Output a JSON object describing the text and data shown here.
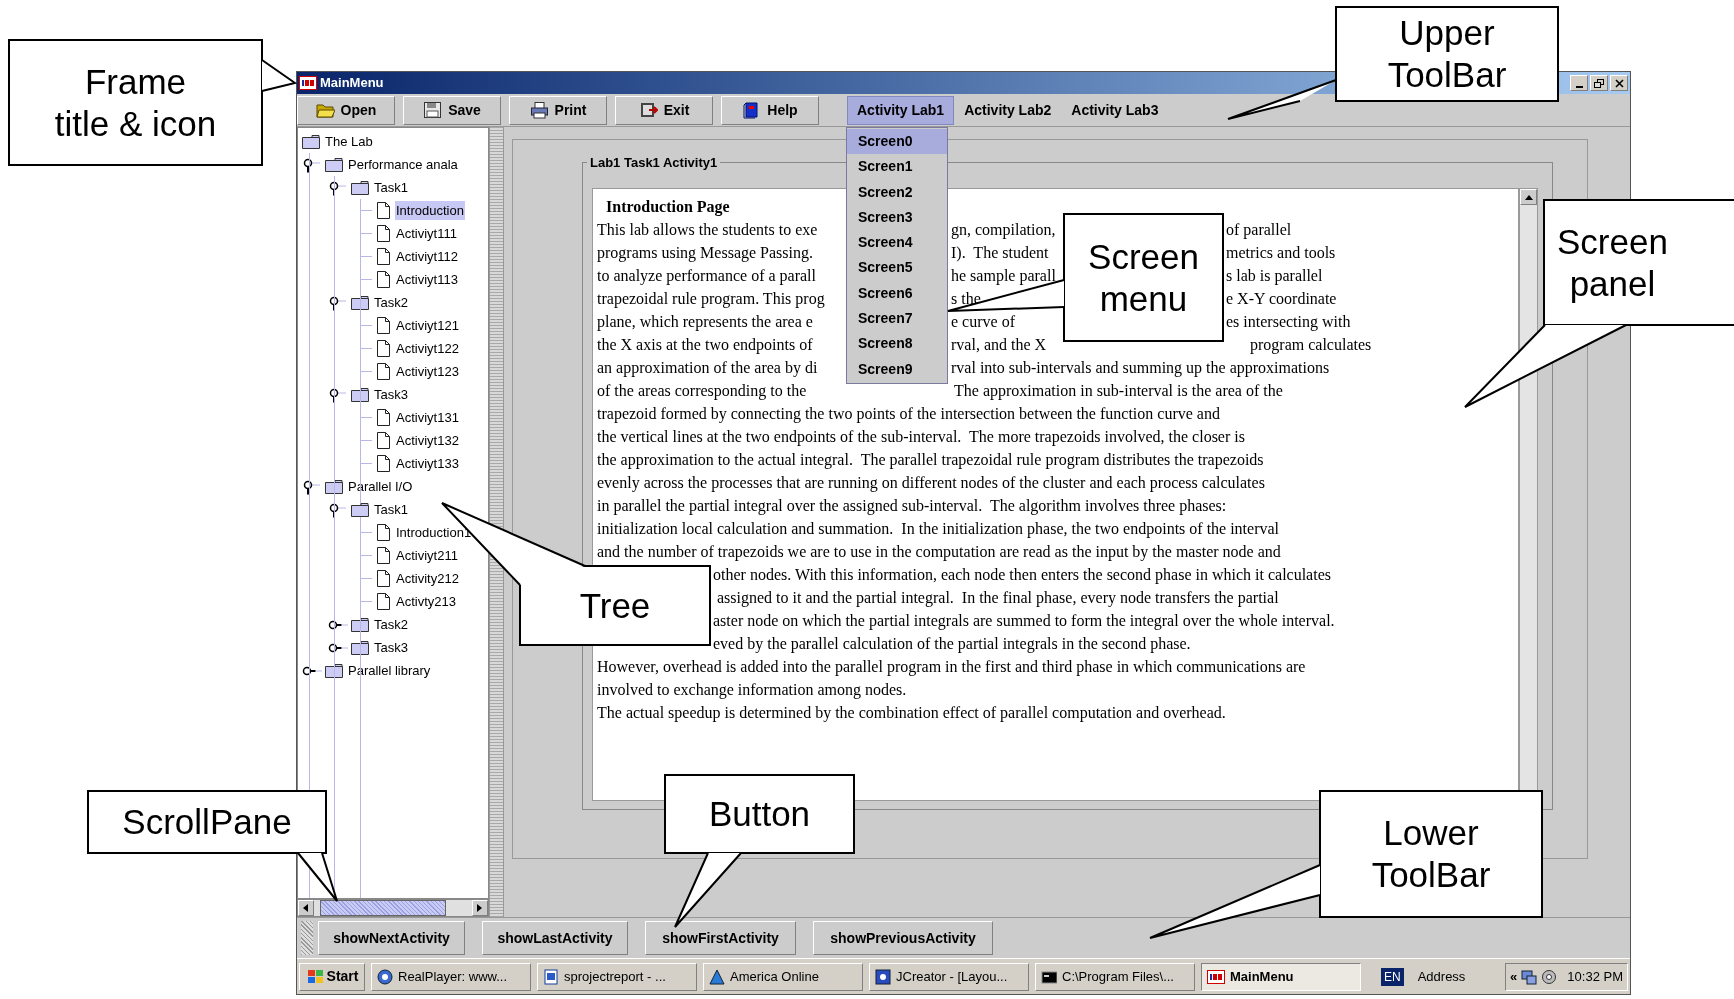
{
  "window": {
    "title": "MainMenu"
  },
  "toolbar": {
    "buttons": [
      "Open",
      "Save",
      "Print",
      "Exit",
      "Help"
    ],
    "menus": [
      {
        "label": "Activity Lab1",
        "selected": true
      },
      {
        "label": "Activity Lab2",
        "selected": false
      },
      {
        "label": "Activity Lab3",
        "selected": false
      }
    ]
  },
  "screen_menu": {
    "items": [
      {
        "label": "Screen0",
        "selected": true
      },
      {
        "label": "Screen1",
        "selected": false
      },
      {
        "label": "Screen2",
        "selected": false
      },
      {
        "label": "Screen3",
        "selected": false
      },
      {
        "label": "Screen4",
        "selected": false
      },
      {
        "label": "Screen5",
        "selected": false
      },
      {
        "label": "Screen6",
        "selected": false
      },
      {
        "label": "Screen7",
        "selected": false
      },
      {
        "label": "Screen8",
        "selected": false
      },
      {
        "label": "Screen9",
        "selected": false
      }
    ]
  },
  "tree": {
    "label": "The Lab",
    "kind": "folder",
    "selected": false,
    "children": [
      {
        "label": "Performance anala",
        "kind": "folder",
        "expanded": true,
        "selected": false,
        "children": [
          {
            "label": "Task1",
            "kind": "folder",
            "expanded": true,
            "selected": false,
            "children": [
              {
                "label": "Introduction",
                "kind": "file",
                "selected": true
              },
              {
                "label": "Activiyt111",
                "kind": "file",
                "selected": false
              },
              {
                "label": "Activiyt112",
                "kind": "file",
                "selected": false
              },
              {
                "label": "Activiyt113",
                "kind": "file",
                "selected": false
              }
            ]
          },
          {
            "label": "Task2",
            "kind": "folder",
            "expanded": true,
            "selected": false,
            "children": [
              {
                "label": "Activiyt121",
                "kind": "file",
                "selected": false
              },
              {
                "label": "Activiyt122",
                "kind": "file",
                "selected": false
              },
              {
                "label": "Activiyt123",
                "kind": "file",
                "selected": false
              }
            ]
          },
          {
            "label": "Task3",
            "kind": "folder",
            "expanded": true,
            "selected": false,
            "children": [
              {
                "label": "Activiyt131",
                "kind": "file",
                "selected": false
              },
              {
                "label": "Activiyt132",
                "kind": "file",
                "selected": false
              },
              {
                "label": "Activiyt133",
                "kind": "file",
                "selected": false
              }
            ]
          }
        ]
      },
      {
        "label": "Parallel I/O",
        "kind": "folder",
        "expanded": true,
        "selected": false,
        "children": [
          {
            "label": "Task1",
            "kind": "folder",
            "expanded": true,
            "selected": false,
            "children": [
              {
                "label": "Introduction1",
                "kind": "file",
                "selected": false
              },
              {
                "label": "Activiyt211",
                "kind": "file",
                "selected": false
              },
              {
                "label": "Activity212",
                "kind": "file",
                "selected": false
              },
              {
                "label": "Activty213",
                "kind": "file",
                "selected": false
              }
            ]
          },
          {
            "label": "Task2",
            "kind": "folder",
            "expanded": false,
            "selected": false
          },
          {
            "label": "Task3",
            "kind": "folder",
            "expanded": false,
            "selected": false
          }
        ]
      },
      {
        "label": "Parallel library",
        "kind": "folder",
        "expanded": false,
        "selected": false
      }
    ]
  },
  "panel": {
    "title": "Lab1 Task1 Activity1",
    "heading": "Introduction Page",
    "lines": [
      {
        "segments": [
          "This lab allows the students to exe",
          "gn, compilation,",
          "of parallel"
        ]
      },
      {
        "segments": [
          "programs using Message Passing.",
          "I).  The student",
          "metrics and tools"
        ]
      },
      {
        "segments": [
          "to analyze performance of a parall",
          "he sample parall",
          "s lab is parallel"
        ]
      },
      {
        "segments": [
          "trapezoidal rule program. This prog",
          "s the",
          "e X-Y coordinate"
        ]
      },
      {
        "segments": [
          "plane, which represents the area e",
          "e curve of",
          "es intersecting with"
        ]
      },
      {
        "segments": [
          "the X axis at the two endpoints of",
          "rval, and the X",
          "program calculates"
        ]
      },
      {
        "segments": [
          "an approximation of the area by di",
          "rval into sub-intervals and summing up the approximations"
        ]
      },
      {
        "segments": [
          "of the areas corresponding to the",
          "The approximation in sub-interval is the area of the"
        ]
      },
      {
        "segments": [
          "trapezoid formed by connecting the two points of the intersection between the function curve and"
        ]
      },
      {
        "segments": [
          "the vertical lines at the two endpoints of the sub-interval.  The more trapezoids involved, the closer is"
        ]
      },
      {
        "segments": [
          "the approximation to the actual integral.  The parallel trapezoidal rule program distributes the trapezoids"
        ]
      },
      {
        "segments": [
          "evenly across the processes that are running on different nodes of the cluster and each process calculates"
        ]
      },
      {
        "segments": [
          "in parallel the partial integral over the assigned sub-interval.  The algorithm involves three phases:"
        ]
      },
      {
        "segments": [
          "initialization local calculation and summation.  In the initialization phase, the two endpoints of the interval"
        ]
      },
      {
        "segments": [
          "and the number of trapezoids we are to use in the computation are read as the input by the master node and"
        ]
      },
      {
        "segments": [
          "other nodes. With this information, each node then enters the second phase in which it calculates"
        ]
      },
      {
        "segments": [
          "assigned to it and the partial integral.  In the final phase, every node transfers the partial"
        ]
      },
      {
        "segments": [
          "aster node on which the partial integrals are summed to form the integral over the whole interval."
        ]
      },
      {
        "segments": [
          "eved by the parallel calculation of the partial integrals in the second phase."
        ]
      },
      {
        "segments": [
          "However, overhead is added into the parallel program in the first and third phase in which communications are"
        ]
      },
      {
        "segments": [
          "involved to exchange information among nodes."
        ]
      },
      {
        "segments": [
          "The actual speedup is determined by the combination effect of parallel computation and overhead."
        ]
      }
    ]
  },
  "lower_toolbar": {
    "buttons": [
      "showNextActivity",
      "showLastActivity",
      "showFirstActivity",
      "showPreviousActivity"
    ]
  },
  "taskbar": {
    "start": "Start",
    "items": [
      {
        "label": "RealPlayer: www...",
        "selected": false
      },
      {
        "label": "sprojectreport - ...",
        "selected": false
      },
      {
        "label": "America Online",
        "selected": false
      },
      {
        "label": "JCreator - [Layou...",
        "selected": false
      },
      {
        "label": "C:\\Program Files\\...",
        "selected": false
      },
      {
        "label": "MainMenu",
        "selected": true
      }
    ],
    "language": "EN",
    "address": "Address",
    "chevron": "«",
    "clock": "10:32 PM"
  },
  "callouts": [
    {
      "lines": [
        "Frame",
        "title & icon"
      ]
    },
    {
      "lines": [
        "Upper",
        "ToolBar"
      ]
    },
    {
      "lines": [
        "Screen",
        "menu"
      ]
    },
    {
      "lines": [
        "Screen",
        "panel"
      ]
    },
    {
      "lines": [
        "Tree"
      ]
    },
    {
      "lines": [
        "ScrollPane"
      ]
    },
    {
      "lines": [
        "Button"
      ]
    },
    {
      "lines": [
        "Lower",
        "ToolBar"
      ]
    }
  ]
}
